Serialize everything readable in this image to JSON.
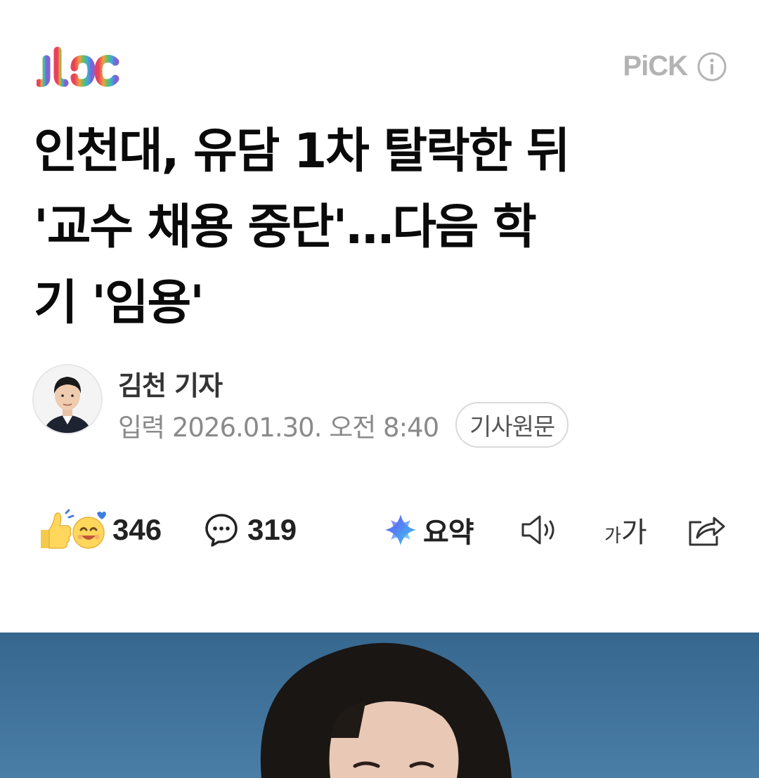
{
  "header": {
    "brand": "jtbc",
    "pick_label": "PiCK",
    "info_icon": "info-icon"
  },
  "article": {
    "headline_lines": [
      "인천대, 유담 1차 탈락한 뒤",
      "'교수 채용 중단'…다음 학",
      "기 '임용'"
    ],
    "reporter": "김천 기자",
    "date": "입력 2026.01.30. 오전 8:40",
    "original_button": "기사원문"
  },
  "actions": {
    "reaction_count": "346",
    "comment_count": "319",
    "summary_label": "요약",
    "font_small": "가",
    "font_large": "가",
    "icons": [
      "reaction-icon",
      "comment-icon",
      "ai-summary-icon",
      "speaker-icon",
      "font-size-icon",
      "share-icon"
    ]
  },
  "colors": {
    "accent_gray": "#b3b3b3",
    "photo_bg": "#3e6f96"
  }
}
